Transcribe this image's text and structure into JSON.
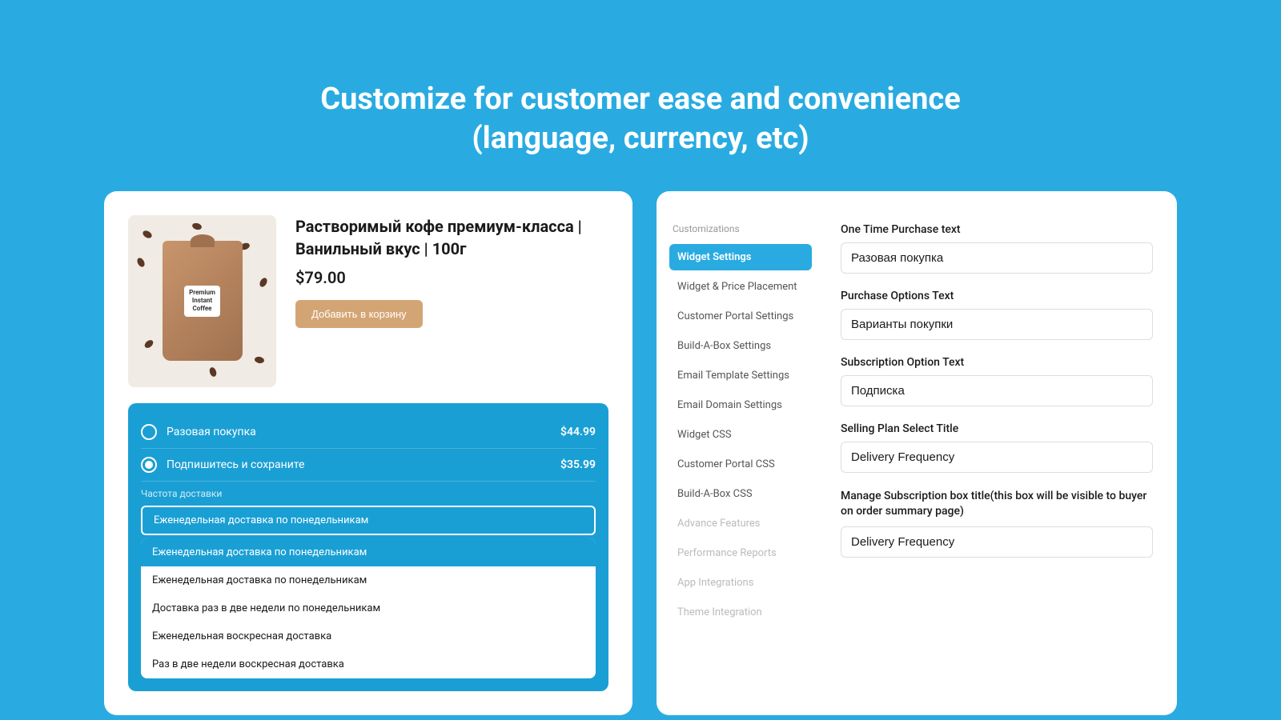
{
  "headline": {
    "line1": "Customize for customer ease and convenience",
    "line2": "(language, currency, etc)"
  },
  "left_card": {
    "product": {
      "title": "Растворимый кофе премиум-класса | Ванильный вкус | 100г",
      "price": "$79.00",
      "add_to_cart": "Добавить в корзину",
      "image_label_line1": "Premium",
      "image_label_line2": "Instant",
      "image_label_line3": "Coffee"
    },
    "options": {
      "one_time_label": "Разовая покупка",
      "one_time_price": "$44.99",
      "subscribe_label": "Подпишитесь и сохраните",
      "subscribe_price": "$35.99",
      "frequency_label": "Частота доставки"
    },
    "frequency_items": [
      {
        "text": "Еженедельная доставка по понедельникам",
        "highlighted": true
      },
      {
        "text": "Еженедельная доставка по понедельникам",
        "highlighted": false
      },
      {
        "text": "Доставка раз в две недели по понедельникам",
        "highlighted": false
      },
      {
        "text": "Еженедельная воскресная доставка",
        "highlighted": false
      },
      {
        "text": "Раз в две недели воскресная доставка",
        "highlighted": false
      }
    ]
  },
  "right_card": {
    "sidebar": {
      "section_label": "Customizations",
      "items": [
        {
          "label": "Widget Settings",
          "active": true,
          "disabled": false
        },
        {
          "label": "Widget & Price Placement",
          "active": false,
          "disabled": false
        },
        {
          "label": "Customer Portal Settings",
          "active": false,
          "disabled": false
        },
        {
          "label": "Build-A-Box Settings",
          "active": false,
          "disabled": false
        },
        {
          "label": "Email Template Settings",
          "active": false,
          "disabled": false
        },
        {
          "label": "Email Domain Settings",
          "active": false,
          "disabled": false
        },
        {
          "label": "Widget CSS",
          "active": false,
          "disabled": false
        },
        {
          "label": "Customer Portal CSS",
          "active": false,
          "disabled": false
        },
        {
          "label": "Build-A-Box CSS",
          "active": false,
          "disabled": false
        },
        {
          "label": "Advance Features",
          "active": false,
          "disabled": true
        },
        {
          "label": "Performance Reports",
          "active": false,
          "disabled": true
        },
        {
          "label": "App Integrations",
          "active": false,
          "disabled": true
        },
        {
          "label": "Theme Integration",
          "active": false,
          "disabled": true
        }
      ]
    },
    "fields": [
      {
        "label": "One Time Purchase text",
        "value": "Разовая покупка"
      },
      {
        "label": "Purchase Options Text",
        "value": "Варианты покупки"
      },
      {
        "label": "Subscription Option Text",
        "value": "Подписка"
      },
      {
        "label": "Selling Plan Select Title",
        "value": "Delivery Frequency"
      },
      {
        "label": "Manage Subscription box title(this box will be visible to buyer on order summary page)",
        "value": "Delivery Frequency",
        "multiline": true
      }
    ]
  }
}
